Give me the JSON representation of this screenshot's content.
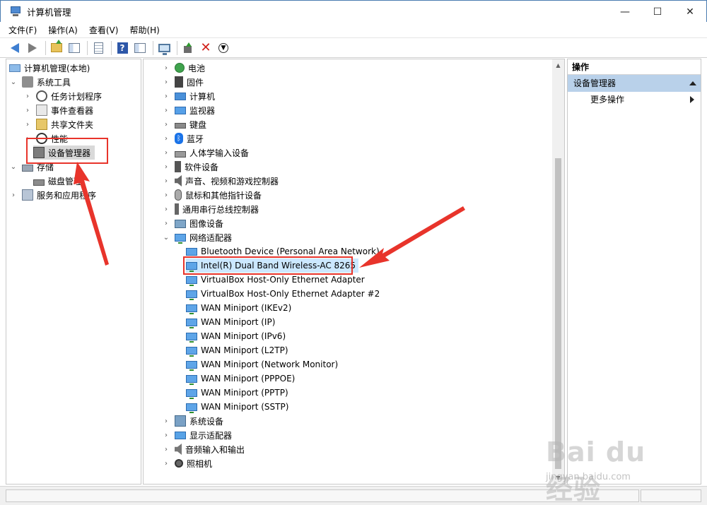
{
  "window": {
    "title": "计算机管理",
    "controls": {
      "minimize": "—",
      "maximize": "☐",
      "close": "✕"
    }
  },
  "menu": [
    "文件(F)",
    "操作(A)",
    "查看(V)",
    "帮助(H)"
  ],
  "left_tree": {
    "root": "计算机管理(本地)",
    "system_tools": "系统工具",
    "task_scheduler": "任务计划程序",
    "event_viewer": "事件查看器",
    "shared_folders": "共享文件夹",
    "performance": "性能",
    "device_manager": "设备管理器",
    "storage": "存储",
    "disk_management": "磁盘管理",
    "services_apps": "服务和应用程序"
  },
  "device_tree": {
    "categories_before": [
      "电池",
      "固件",
      "计算机",
      "监视器",
      "键盘",
      "蓝牙",
      "人体学输入设备",
      "软件设备",
      "声音、视频和游戏控制器",
      "鼠标和其他指针设备",
      "通用串行总线控制器",
      "图像设备"
    ],
    "network_adapters_label": "网络适配器",
    "network_adapters": [
      "Bluetooth Device (Personal Area Network)",
      "Intel(R) Dual Band Wireless-AC 8265",
      "VirtualBox Host-Only Ethernet Adapter",
      "VirtualBox Host-Only Ethernet Adapter #2",
      "WAN Miniport (IKEv2)",
      "WAN Miniport (IP)",
      "WAN Miniport (IPv6)",
      "WAN Miniport (L2TP)",
      "WAN Miniport (Network Monitor)",
      "WAN Miniport (PPPOE)",
      "WAN Miniport (PPTP)",
      "WAN Miniport (SSTP)"
    ],
    "categories_after": [
      "系统设备",
      "显示适配器",
      "音频输入和输出",
      "照相机"
    ]
  },
  "actions_pane": {
    "header": "操作",
    "section": "设备管理器",
    "more": "更多操作"
  },
  "watermark": {
    "brand": "Bai du 经验",
    "sub": "jingyan.baidu.com"
  },
  "colors": {
    "selection": "#cce8ff",
    "highlight": "#e8342b",
    "section": "#b9d1ea"
  }
}
